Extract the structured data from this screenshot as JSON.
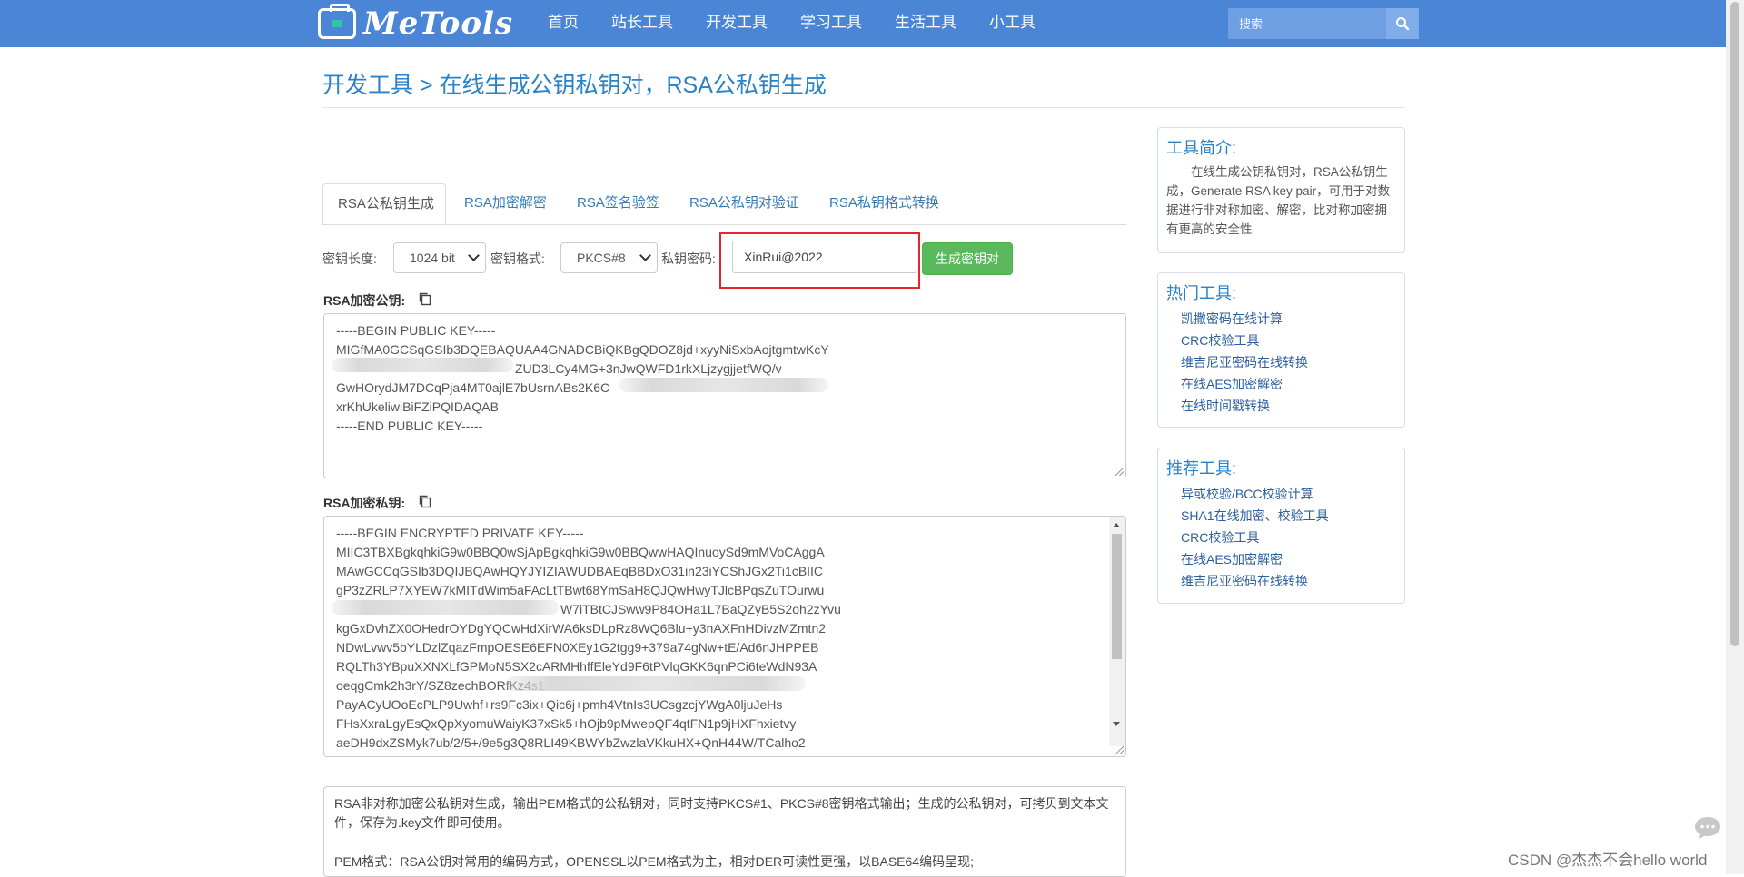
{
  "header": {
    "logo_text": "MeTools",
    "nav": [
      "首页",
      "站长工具",
      "开发工具",
      "学习工具",
      "生活工具",
      "小工具"
    ],
    "search": {
      "placeholder": "搜索",
      "icon": "search-icon"
    }
  },
  "page": {
    "title": "开发工具 > 在线生成公钥私钥对，RSA公私钥生成"
  },
  "tabs": [
    "RSA公私钥生成",
    "RSA加密解密",
    "RSA签名验签",
    "RSA公私钥对验证",
    "RSA私钥格式转换"
  ],
  "form": {
    "key_length_label": "密钥长度:",
    "key_length_value": "1024 bit",
    "key_format_label": "密钥格式:",
    "key_format_value": "PKCS#8",
    "password_label": "私钥密码:",
    "password_value": "XinRui@2022",
    "generate_button": "生成密钥对"
  },
  "public_key": {
    "label": "RSA加密公钥:",
    "lines": [
      "-----BEGIN PUBLIC KEY-----",
      "MIGfMA0GCSqGSIb3DQEBAQUAA4GNADCBiQKBgQDOZ8jd+xyyNiSxbAojtgmtwKcY",
      "ZUD3LCy4MG+3nJwQWFD1rkXLjzygjjetfWQ/v",
      "GwHOrydJM7DCqPja4MT0ajlE7bUsrnABs2K6C",
      "xrKhUkeliwiBiFZiPQIDAQAB",
      "-----END PUBLIC KEY-----"
    ]
  },
  "private_key": {
    "label": "RSA加密私钥:",
    "lines": [
      "-----BEGIN ENCRYPTED PRIVATE KEY-----",
      "MIIC3TBXBgkqhkiG9w0BBQ0wSjApBgkqhkiG9w0BBQwwHAQInuoySd9mMVoCAggA",
      "MAwGCCqGSIb3DQIJBQAwHQYJYIZIAWUDBAEqBBDxO31in23iYCShJGx2Ti1cBIIC",
      "gP3zZRLP7XYEW7kMITdWim5aFAcLtTBwt68YmSaH8QJQwHwyTJlcBPqsZuTOurwu",
      "W7iTBtCJSww9P84OHa1L7BaQZyB5S2oh2zYvu",
      "kgGxDvhZX0OHedrOYDgYQCwHdXirWA6ksDLpRz8WQ6Blu+y3nAXFnHDivzMZmtn2",
      "NDwLvwv5bYLDzlZqazFmpOESE6EFN0XEy1G2tgg9+379a74gNw+tE/Ad6nJHPPEB",
      "RQLTh3YBpuXXNXLfGPMoN5SX2cARMHhffEleYd9F6tPVlqGKK6qnPCi6teWdN93A",
      "oeqgCmk2h3rY/SZ8zechBORfKz4s1",
      "PayACyUOoEcPLP9Uwhf+rs9Fc3ix+Qic6j+pmh4VtnIs3UCsgzcjYWgA0ljuJeHs",
      "FHsXxraLgyEsQxQpXyomuWaiyK37xSk5+hOjb9pMwepQF4qtFN1p9jHXFhxietvy",
      "aeDH9dxZSMyk7ub/2/5+/9e5g3Q8RLI49KBWYbZwzlaVKkuHX+QnH44W/TCalho2"
    ]
  },
  "description": {
    "p1": "RSA非对称加密公私钥对生成，输出PEM格式的公私钥对，同时支持PKCS#1、PKCS#8密钥格式输出；生成的公私钥对，可拷贝到文本文件，保存为.key文件即可使用。",
    "p2": "PEM格式：RSA公钥对常用的编码方式，OPENSSL以PEM格式为主，相对DER可读性更强，以BASE64编码呈现;"
  },
  "sidebar": {
    "intro": {
      "title": "工具简介:",
      "text": "在线生成公钥私钥对，RSA公私钥生成，Generate RSA key pair，可用于对数据进行非对称加密、解密，比对称加密拥有更高的安全性"
    },
    "hot": {
      "title": "热门工具:",
      "items": [
        "凯撒密码在线计算",
        "CRC校验工具",
        "维吉尼亚密码在线转换",
        "在线AES加密解密",
        "在线时间戳转换"
      ]
    },
    "recommend": {
      "title": "推荐工具:",
      "items": [
        "异或校验/BCC校验计算",
        "SHA1在线加密、校验工具",
        "CRC校验工具",
        "在线AES加密解密",
        "维吉尼亚密码在线转换"
      ]
    }
  },
  "watermark": "CSDN @杰杰不会hello world",
  "colors": {
    "navbar": "#4b86d6",
    "link": "#2a82c9",
    "button": "#5cb85c",
    "highlight": "#e5262e"
  }
}
